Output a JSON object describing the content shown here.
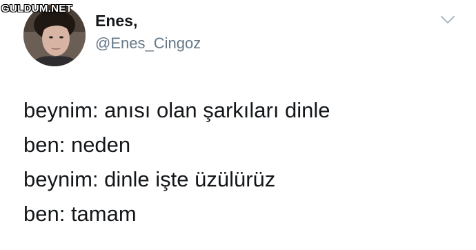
{
  "watermark": "GULDUM.NET",
  "tweet": {
    "display_name": "Enes,",
    "handle": "@Enes_Cingoz",
    "lines": [
      "beynim: anısı olan şarkıları dinle",
      "ben: neden",
      "beynim: dinle işte üzülürüz",
      "ben: tamam"
    ]
  },
  "icons": {
    "menu": "chevron-down-icon"
  },
  "colors": {
    "text": "#14171a",
    "handle": "#657786",
    "caret": "#aab8c2"
  }
}
